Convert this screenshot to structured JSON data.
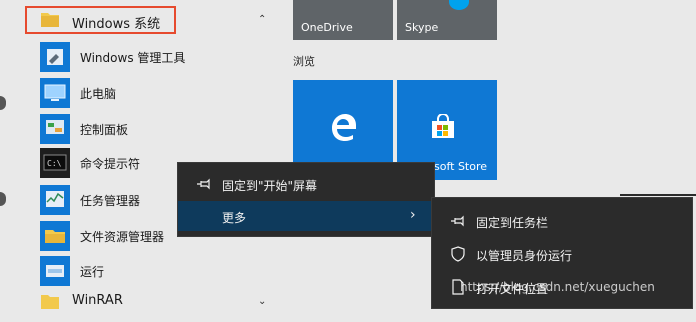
{
  "applist": {
    "folder_label": "Windows 系统",
    "items": [
      {
        "label": "Windows 管理工具",
        "icon": "admin-tools-icon"
      },
      {
        "label": "此电脑",
        "icon": "this-pc-icon"
      },
      {
        "label": "控制面板",
        "icon": "control-panel-icon"
      },
      {
        "label": "命令提示符",
        "icon": "command-prompt-icon"
      },
      {
        "label": "任务管理器",
        "icon": "task-manager-icon"
      },
      {
        "label": "文件资源管理器",
        "icon": "file-explorer-icon"
      },
      {
        "label": "运行",
        "icon": "run-icon"
      }
    ],
    "next_group_label": "WinRAR"
  },
  "tiles": {
    "onedrive_label": "OneDrive",
    "skype_label": "Skype",
    "section_label": "浏览",
    "store_label": "soft Store"
  },
  "context_menu": {
    "items": [
      {
        "label": "固定到\"开始\"屏幕",
        "icon": "pin-icon"
      },
      {
        "label": "更多",
        "icon": "",
        "selected": true
      }
    ]
  },
  "submenu": {
    "items": [
      {
        "label": "固定到任务栏",
        "icon": "pin-icon"
      },
      {
        "label": "以管理员身份运行",
        "icon": "shield-icon"
      },
      {
        "label": "打开文件位置",
        "icon": "file-icon"
      }
    ]
  },
  "watermark": "https://blog.csdn.net/xueguchen",
  "colors": {
    "tile_blue": "#0f78d4",
    "tile_gray": "#5f6468",
    "menu_bg": "#2b2b2b",
    "menu_selected": "#0e3a5c",
    "highlight_border": "#e64a2e"
  }
}
